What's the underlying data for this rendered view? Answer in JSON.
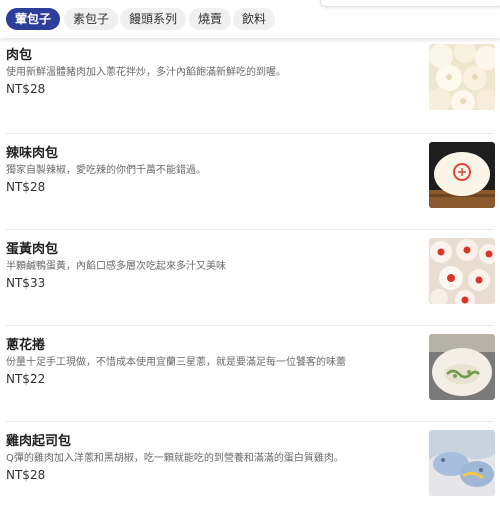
{
  "categories": [
    {
      "label": "葷包子",
      "active": true
    },
    {
      "label": "素包子",
      "active": false
    },
    {
      "label": "饅頭系列",
      "active": false
    },
    {
      "label": "燒賣",
      "active": false
    },
    {
      "label": "飲料",
      "active": false
    }
  ],
  "items": [
    {
      "name": "肉包",
      "desc": "使用新鮮溫體豬肉加入蔥花拌炒，多汁內餡飽滿新鮮吃的到喔。",
      "price": "NT$28",
      "image": "plain-buns-photo"
    },
    {
      "name": "辣味肉包",
      "desc": "獨家自製辣椒，愛吃辣的你們千萬不能錯過。",
      "price": "NT$28",
      "image": "stamped-bun-photo"
    },
    {
      "name": "蛋黃肉包",
      "desc": "半顆鹹鴨蛋黃，內餡口感多層次吃起來多汁又美味",
      "price": "NT$33",
      "image": "red-stamped-buns-photo"
    },
    {
      "name": "蔥花捲",
      "desc": "份量十足手工現做，不惜成本使用宜蘭三星蔥，就是要滿足每一位饕客的味蕾",
      "price": "NT$22",
      "image": "scallion-roll-photo"
    },
    {
      "name": "雞肉起司包",
      "desc": "Q彈的雞肉加入洋蔥和黑胡椒，吃一顆就能吃的到營養和滿滿的蛋白質雞肉。",
      "price": "NT$28",
      "image": "chicken-cheese-bun-photo"
    }
  ]
}
